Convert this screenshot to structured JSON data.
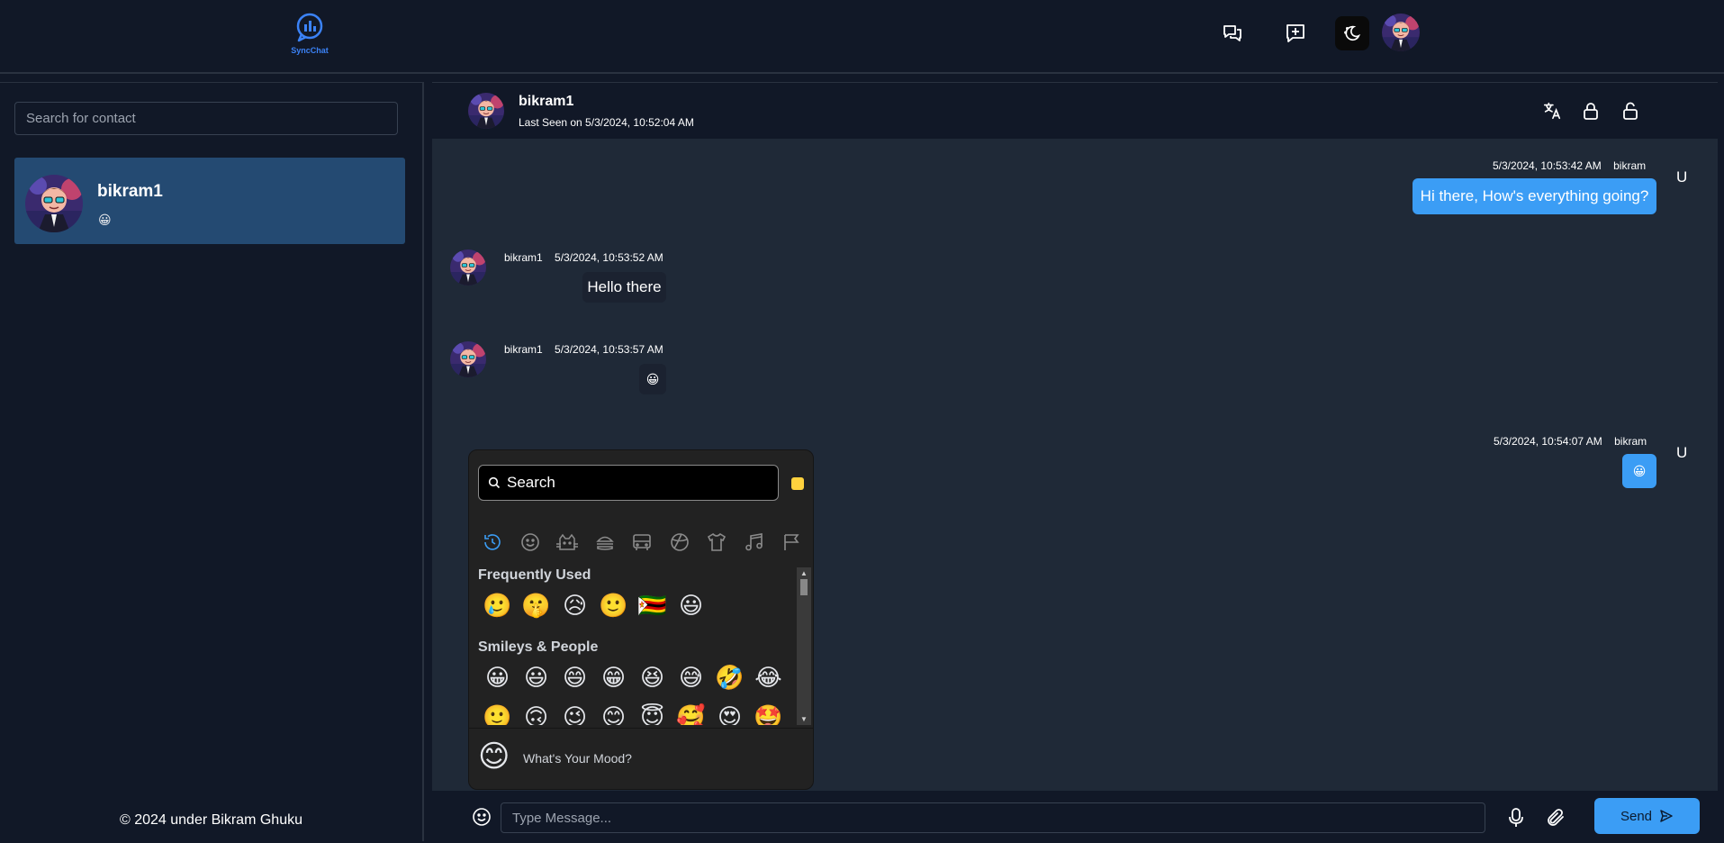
{
  "app": {
    "logo_text": "SyncChat"
  },
  "sidebar": {
    "search_placeholder": "Search for contact",
    "contacts": [
      {
        "name": "bikram1",
        "last_message": "😀"
      }
    ],
    "copyright": "© 2024 under Bikram Ghuku"
  },
  "chat": {
    "contact_name": "bikram1",
    "last_seen": "Last Seen on 5/3/2024, 10:52:04 AM",
    "messages": [
      {
        "direction": "out",
        "timestamp": "5/3/2024, 10:53:42 AM",
        "sender": "bikram",
        "avatar_letter": "U",
        "text": "Hi there, How's everything going?"
      },
      {
        "direction": "in",
        "sender": "bikram1",
        "timestamp": "5/3/2024, 10:53:52 AM",
        "text": "Hello there"
      },
      {
        "direction": "in",
        "sender": "bikram1",
        "timestamp": "5/3/2024, 10:53:57 AM",
        "text": "😀"
      },
      {
        "direction": "out",
        "timestamp": "5/3/2024, 10:54:07 AM",
        "sender": "bikram",
        "avatar_letter": "U",
        "text": "😀"
      }
    ]
  },
  "emoji_picker": {
    "search_placeholder": "Search",
    "skin_tone_color": "#ffd23e",
    "categories": [
      "recent-icon",
      "smiley-icon",
      "cat-icon",
      "food-icon",
      "travel-icon",
      "sports-icon",
      "shirt-icon",
      "music-icon",
      "flag-icon"
    ],
    "frequently_used_heading": "Frequently Used",
    "frequently_used": [
      "🥲",
      "🤫",
      "😥",
      "🙂",
      "🇿🇼",
      "😃"
    ],
    "smileys_heading": "Smileys & People",
    "smileys_row1": [
      "😀",
      "😃",
      "😄",
      "😁",
      "😆",
      "😅",
      "🤣",
      "😂"
    ],
    "smileys_row2": [
      "🙂",
      "🙃",
      "😉",
      "😊",
      "😇",
      "🥰",
      "😍",
      "🤩"
    ],
    "mood_face": "😊",
    "mood_prompt": "What's Your Mood?"
  },
  "composer": {
    "placeholder": "Type Message...",
    "send_label": "Send"
  },
  "colors": {
    "background": "#111827",
    "chat_background": "#1f2937",
    "accent": "#3b9df5",
    "selected_contact": "#244a72"
  }
}
